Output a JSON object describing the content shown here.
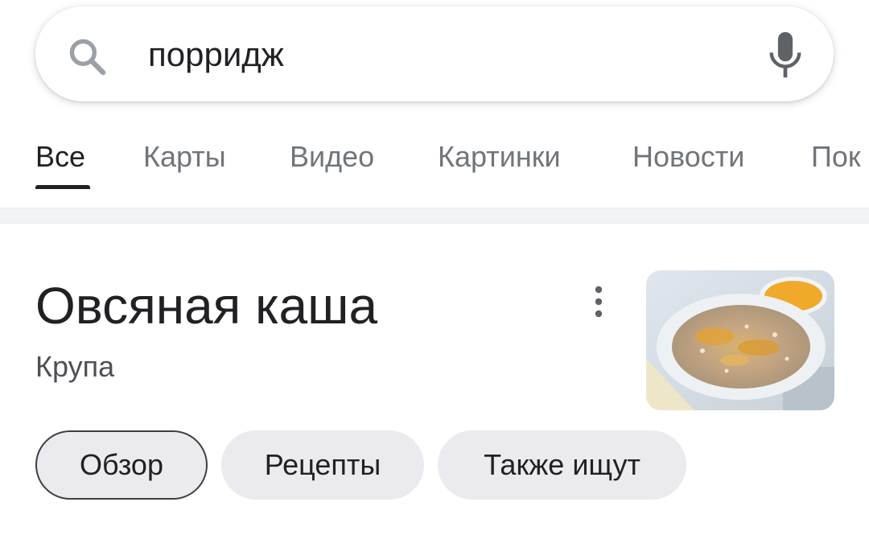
{
  "search": {
    "query": "порридж",
    "search_icon": "search-icon",
    "mic_icon": "mic-icon"
  },
  "tabs": [
    {
      "label": "Все",
      "active": true
    },
    {
      "label": "Карты"
    },
    {
      "label": "Видео"
    },
    {
      "label": "Картинки"
    },
    {
      "label": "Новости"
    },
    {
      "label": "Пок"
    }
  ],
  "knowledge_panel": {
    "title": "Овсяная каша",
    "subtitle": "Крупа",
    "more_icon": "more-vert-icon",
    "image_alt": "oatmeal-bowl-image"
  },
  "chips": [
    {
      "label": "Обзор",
      "active": true
    },
    {
      "label": "Рецепты"
    },
    {
      "label": "Также ищут"
    }
  ],
  "colors": {
    "text_primary": "#202124",
    "text_secondary": "#70757a",
    "chip_bg": "#ebebef",
    "divider": "#f1f3f4"
  }
}
